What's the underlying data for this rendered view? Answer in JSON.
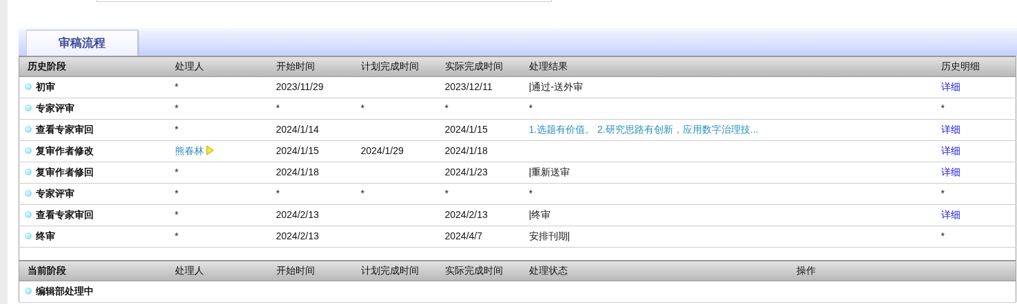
{
  "tab": {
    "label": "审稿流程",
    "selected": true
  },
  "history": {
    "columns": [
      "历史阶段",
      "处理人",
      "开始时间",
      "计划完成时间",
      "实际完成时间",
      "处理结果",
      "历史明细"
    ],
    "rows": [
      {
        "stage": "初审",
        "handler": {
          "text": "*",
          "kind": "text"
        },
        "start": "2023/11/29",
        "actual": "2023/12/11",
        "result": {
          "text": "|通过-送外审",
          "kind": "text"
        },
        "detail": {
          "text": "详细",
          "kind": "link"
        }
      },
      {
        "stage": "专家评审",
        "handler": {
          "text": "*",
          "kind": "text"
        },
        "start": "*",
        "planned": "*",
        "actual": "*",
        "result": {
          "text": "*",
          "kind": "text"
        },
        "detail": {
          "text": "*",
          "kind": "text"
        }
      },
      {
        "stage": "查看专家审回",
        "handler": {
          "text": "*",
          "kind": "text"
        },
        "start": "2024/1/14",
        "actual": "2024/1/15",
        "result": {
          "text": "1.选题有价值。 2.研究思路有创新，应用数字治理技...",
          "kind": "link"
        },
        "detail": {
          "text": "详细",
          "kind": "link"
        }
      },
      {
        "stage": "复审作者修改",
        "handler": {
          "text": "熊春林",
          "kind": "link"
        },
        "start": "2024/1/15",
        "planned": "2024/1/29",
        "actual": "2024/1/18",
        "detail": {
          "text": "详细",
          "kind": "link"
        }
      },
      {
        "stage": "复审作者修回",
        "handler": {
          "text": "*",
          "kind": "text"
        },
        "start": "2024/1/18",
        "actual": "2024/1/23",
        "result": {
          "text": "|重新送审",
          "kind": "text"
        },
        "detail": {
          "text": "详细",
          "kind": "link"
        }
      },
      {
        "stage": "专家评审",
        "handler": {
          "text": "*",
          "kind": "text"
        },
        "start": "*",
        "planned": "*",
        "actual": "*",
        "result": {
          "text": "*",
          "kind": "text"
        },
        "detail": {
          "text": "*",
          "kind": "text"
        }
      },
      {
        "stage": "查看专家审回",
        "handler": {
          "text": "*",
          "kind": "text"
        },
        "start": "2024/2/13",
        "actual": "2024/2/13",
        "result": {
          "text": "|终审",
          "kind": "text"
        },
        "detail": {
          "text": "详细",
          "kind": "link"
        }
      },
      {
        "stage": "终审",
        "handler": {
          "text": "*",
          "kind": "text"
        },
        "start": "2024/2/13",
        "actual": "2024/4/7",
        "result": {
          "text": "安排刊期|",
          "kind": "text"
        },
        "detail": {
          "text": "*",
          "kind": "text"
        }
      }
    ]
  },
  "current": {
    "columns": [
      "当前阶段",
      "处理人",
      "开始时间",
      "计划完成时间",
      "实际完成时间",
      "处理状态",
      "操作"
    ],
    "rows": [
      {
        "stage": "编辑部处理中"
      }
    ]
  }
}
